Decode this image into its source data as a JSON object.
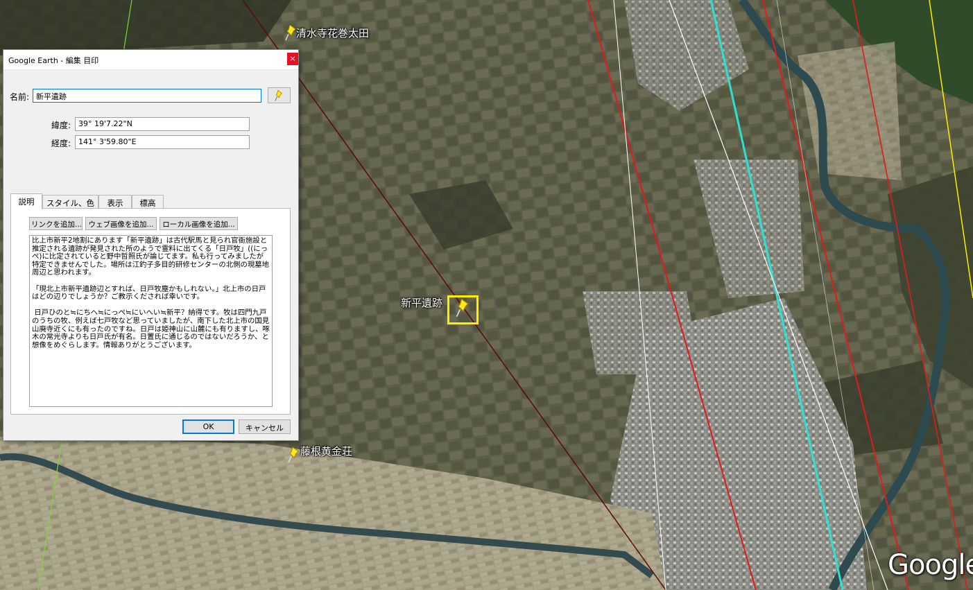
{
  "map": {
    "placemarks": [
      {
        "label": "清水寺花巻太田"
      },
      {
        "label": "新平遺跡"
      },
      {
        "label": "藤根黄金荘"
      }
    ],
    "watermark": "Google"
  },
  "dialog": {
    "title": "Google Earth - 編集 目印",
    "close_symbol": "×",
    "name_label": "名前:",
    "name_value": "新平遺跡",
    "latitude_label": "緯度:",
    "latitude_value": "39° 19'7.22\"N",
    "longitude_label": "経度:",
    "longitude_value": "141° 3'59.80\"E",
    "tabs": [
      {
        "label": "説明",
        "active": true
      },
      {
        "label": "スタイル、色",
        "active": false
      },
      {
        "label": "表示",
        "active": false
      },
      {
        "label": "標高",
        "active": false
      }
    ],
    "buttons": {
      "add_link": "リンクを追加...",
      "add_web_image": "ウェブ画像を追加...",
      "add_local_image": "ローカル画像を追加...",
      "ok": "OK",
      "cancel": "キャンセル"
    },
    "description": "比上市新平2地割にあります「新平遺跡」は古代駅馬と見られ官衙施設と推定される遺跡が発見された所のようで霊料に出てくる「日戸牧」((にっぺ)に比定されていると野中哲照氏が論じてます。私も行ってみましたが特定できませんでした。場所は江釣子多目的研修センターの北側の現墓地周辺と思われます。\n\n「現北上市新平遺跡辺とすれば、日戸牧塵かもしれない。」北上市の日戸はどの辺りでしょうか？ご教示くだされば幸いです。\n\n 日戸ひのと≒にちへ≒にっぺ≒にいへい≒新平？納得です。牧は四門九戸のうちの牧、例えば七戸牧など思っていましたが、南下した北上市の国見山廃寺近くにも有ったのですね。日戸は姫神山に山麓にも有りますし、啄木の常光寺よりも日戸氏が有名。日置氏に通じるのではないだろうか、と想像をめぐらします。情報ありがとうございます。"
  }
}
